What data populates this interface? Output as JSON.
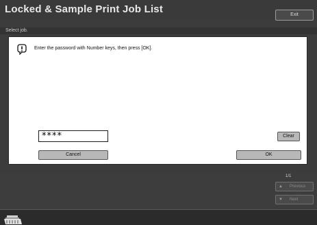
{
  "header": {
    "title": "Locked & Sample Print Job List",
    "exit_label": "Exit"
  },
  "subtitle": {
    "text": "Select job."
  },
  "dialog": {
    "message": "Enter the password with Number keys, then press [OK].",
    "password_value": "****",
    "clear_label": "Clear",
    "cancel_label": "Cancel",
    "ok_label": "OK"
  },
  "pager": {
    "page": "1/1",
    "previous_label": "Previous",
    "next_label": "Next"
  },
  "icons": {
    "info": "info-bubble-icon",
    "previous": "up-arrow-icon",
    "next": "down-arrow-icon",
    "device": "printer-tray-icon"
  },
  "colors": {
    "background": "#3c3c3c",
    "dialog": "#ffffff",
    "button": "#b8b8b8"
  }
}
